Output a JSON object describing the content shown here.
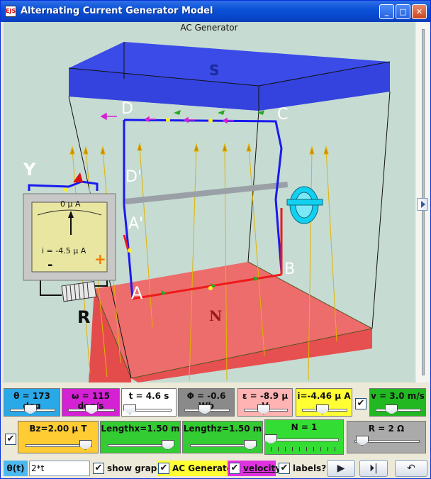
{
  "window": {
    "title": "Alternating Current Generator Model",
    "icon_label": "EJS",
    "minimize": "_",
    "maximize": "□",
    "close": "✕"
  },
  "scene": {
    "caption": "AC Generator",
    "labels": {
      "S": "S",
      "N": "N",
      "A": "A",
      "B": "B",
      "C": "C",
      "D": "D",
      "A_prime": "A'",
      "D_prime": "D'",
      "Y": "Y",
      "R": "R"
    },
    "meter": {
      "scale_text": "0 μ A",
      "reading": "i = -4.5 μ A",
      "minus": "-",
      "plus": "+"
    }
  },
  "sliders_row1": [
    {
      "key": "theta",
      "label": "θ = 173 deg",
      "color": "#2aa9e8",
      "fraction": 0.45
    },
    {
      "key": "omega",
      "label": "ω = 115 deg/s",
      "color": "#d321d3",
      "fraction": 0.5
    },
    {
      "key": "t",
      "label": "t = 4.6 s",
      "color": "#ffffff",
      "fraction": 0.05
    },
    {
      "key": "phi",
      "label": "Φ = -0.6 Wb",
      "color": "#8a8a8a",
      "fraction": 0.45
    },
    {
      "key": "emf",
      "label": "ε = -8.9 μ V",
      "color": "#ffb3b3",
      "fraction": 0.45
    },
    {
      "key": "i",
      "label": "i=-4.46 μ A",
      "color": "#ffff33",
      "fraction": 0.45
    },
    {
      "key": "v",
      "label": "v = 3.0 m/s",
      "color": "#22b822",
      "fraction": 0.35,
      "checked": true
    }
  ],
  "sliders_row2": [
    {
      "key": "Bz",
      "label": "Bz=2.00 μ T",
      "color": "#ffcc33",
      "fraction": 0.9,
      "checked": true
    },
    {
      "key": "lengthx",
      "label": "Lengthx=1.50 m",
      "color": "#33cc33",
      "fraction": 0.9
    },
    {
      "key": "lengthz",
      "label": "Lengthz=1.50 m",
      "color": "#33cc33",
      "fraction": 0.9
    },
    {
      "key": "N",
      "label": "N = 1",
      "color": "#33dd33",
      "fraction": 0.0
    },
    {
      "key": "R",
      "label": "R = 2 Ω",
      "color": "#aaaaaa",
      "fraction": 0.12
    }
  ],
  "bottom": {
    "theta_label": "θ(t)",
    "theta_value": "2*t",
    "show_graph": "show graph",
    "ac_generator": "AC Generator",
    "velocity": "velocity",
    "labels_q": "labels?",
    "play": "▶",
    "step": "⏵|",
    "reset": "↶"
  },
  "colors": {
    "pole_s": "#3a4be8",
    "pole_n": "#f05a5a",
    "background": "#c6dbd2",
    "field_arrow": "#d9a300"
  }
}
